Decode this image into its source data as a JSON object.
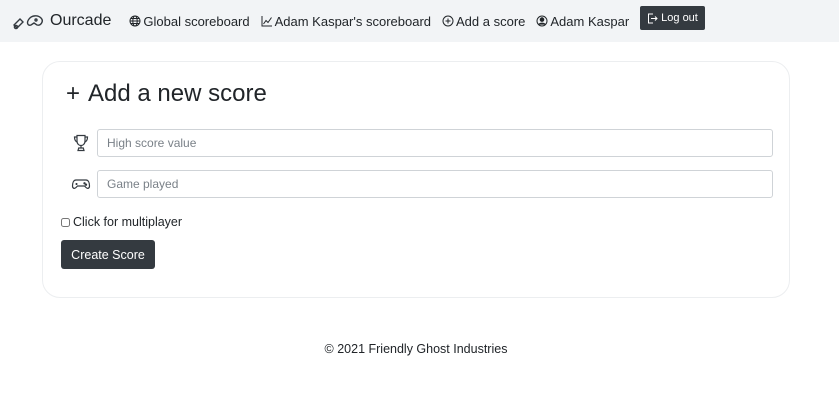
{
  "navbar": {
    "brand": "Ourcade",
    "links": [
      {
        "label": "Global scoreboard",
        "icon": "globe-icon"
      },
      {
        "label": "Adam Kaspar's scoreboard",
        "icon": "chart-line-icon"
      },
      {
        "label": "Add a score",
        "icon": "plus-circle-icon"
      },
      {
        "label": "Adam Kaspar",
        "icon": "user-circle-icon"
      }
    ],
    "logout_label": "Log out"
  },
  "form": {
    "title": "Add a new score",
    "score_placeholder": "High score value",
    "game_placeholder": "Game played",
    "multiplayer_label": "Click for multiplayer",
    "multiplayer_checked": false,
    "submit_label": "Create Score"
  },
  "footer": {
    "text": "© 2021 Friendly Ghost Industries"
  }
}
